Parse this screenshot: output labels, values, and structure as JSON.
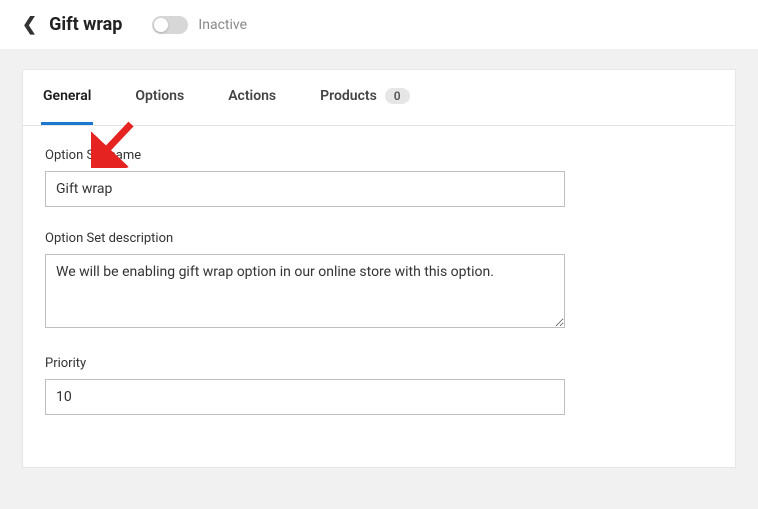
{
  "header": {
    "title": "Gift wrap",
    "toggle_state_label": "Inactive"
  },
  "tabs": [
    {
      "label": "General",
      "active": true
    },
    {
      "label": "Options",
      "active": false
    },
    {
      "label": "Actions",
      "active": false
    },
    {
      "label": "Products",
      "active": false,
      "badge": "0"
    }
  ],
  "form": {
    "name_label": "Option Set name",
    "name_value": "Gift wrap",
    "description_label": "Option Set description",
    "description_value": "We will be enabling gift wrap option in our online store with this option.",
    "priority_label": "Priority",
    "priority_value": "10"
  },
  "annotation": {
    "arrow_color": "#e52421"
  }
}
